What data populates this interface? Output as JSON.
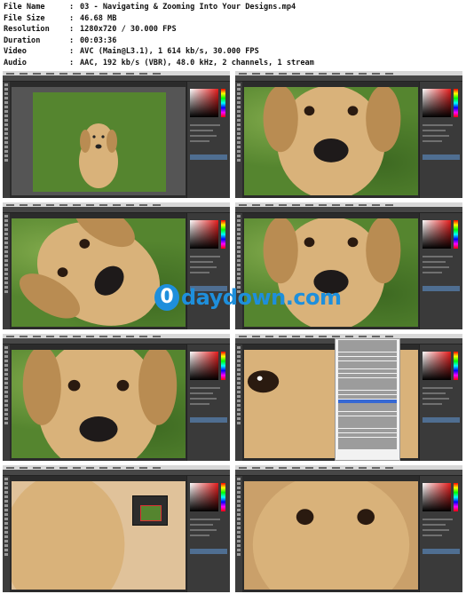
{
  "file_info": {
    "rows": [
      {
        "key": "File Name",
        "value": "03 - Navigating & Zooming Into Your Designs.mp4"
      },
      {
        "key": "File Size",
        "value": "46.68 MB"
      },
      {
        "key": "Resolution",
        "value": "1280x720 / 30.000 FPS"
      },
      {
        "key": "Duration",
        "value": "00:03:36"
      },
      {
        "key": "Video",
        "value": "AVC (Main@L3.1), 1 614 kb/s, 30.000 FPS"
      },
      {
        "key": "Audio",
        "value": "AAC, 192 kb/s (VBR), 48.0 kHz, 2 channels, 1 stream"
      }
    ],
    "separator": ":"
  },
  "thumbnails": [
    {
      "index": 1,
      "view": "full-dog-framed"
    },
    {
      "index": 2,
      "view": "face-zoom"
    },
    {
      "index": 3,
      "view": "rotated-face"
    },
    {
      "index": 4,
      "view": "face-zoom"
    },
    {
      "index": 5,
      "view": "face-close"
    },
    {
      "index": 6,
      "view": "eye-close-menu"
    },
    {
      "index": 7,
      "view": "face-close-navigator"
    },
    {
      "index": 8,
      "view": "eyes-close"
    }
  ],
  "watermark": {
    "letter": "0",
    "text": "daydown.com"
  },
  "colors": {
    "watermark": "#1e8fdc",
    "dog_fur": "#d9b27a",
    "grass": "#55852f",
    "ps_dark": "#2b2b2b"
  }
}
